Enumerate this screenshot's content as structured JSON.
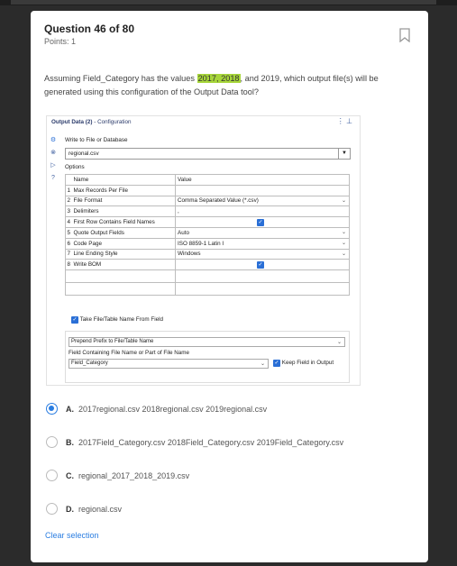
{
  "question": {
    "title": "Question 46 of 80",
    "points": "Points: 1",
    "text_before": "Assuming Field_Category has the values ",
    "text_highlight": "2017, 2018",
    "text_after": ", and 2019, which output file(s) will be generated using this configuration of the Output Data tool?"
  },
  "tool": {
    "title_bold": "Output Data (2)",
    "title_rest": " - Configuration",
    "write_label": "Write to File or Database",
    "file_value": "regional.csv",
    "options_label": "Options",
    "col_name": "Name",
    "col_value": "Value",
    "rows": [
      {
        "num": "1",
        "name": "Max Records Per File",
        "value": ""
      },
      {
        "num": "2",
        "name": "File Format",
        "value": "Comma Separated Value (*.csv)"
      },
      {
        "num": "3",
        "name": "Delimiters",
        "value": ","
      },
      {
        "num": "4",
        "name": "First Row Contains Field Names",
        "value": ""
      },
      {
        "num": "5",
        "name": "Quote Output Fields",
        "value": "Auto"
      },
      {
        "num": "6",
        "name": "Code Page",
        "value": "ISO 8859-1 Latin I"
      },
      {
        "num": "7",
        "name": "Line Ending Style",
        "value": "Windows"
      },
      {
        "num": "8",
        "name": "Write BOM",
        "value": ""
      }
    ],
    "take_name_label": "Take File/Table Name From Field",
    "prepend_value": "Prepend Prefix to File/Table Name",
    "field_label": "Field Containing File Name or Part of File Name",
    "field_value": "Field_Category",
    "keep_field_label": "Keep Field in Output"
  },
  "answers": [
    {
      "letter": "A.",
      "text": "2017regional.csv  2018regional.csv  2019regional.csv",
      "selected": true
    },
    {
      "letter": "B.",
      "text": "2017Field_Category.csv  2018Field_Category.csv  2019Field_Category.csv",
      "selected": false
    },
    {
      "letter": "C.",
      "text": "regional_2017_2018_2019.csv",
      "selected": false
    },
    {
      "letter": "D.",
      "text": "regional.csv",
      "selected": false
    }
  ],
  "clear_label": "Clear selection",
  "colors": {
    "accent": "#2a7de1",
    "highlight": "#a7d63a"
  }
}
